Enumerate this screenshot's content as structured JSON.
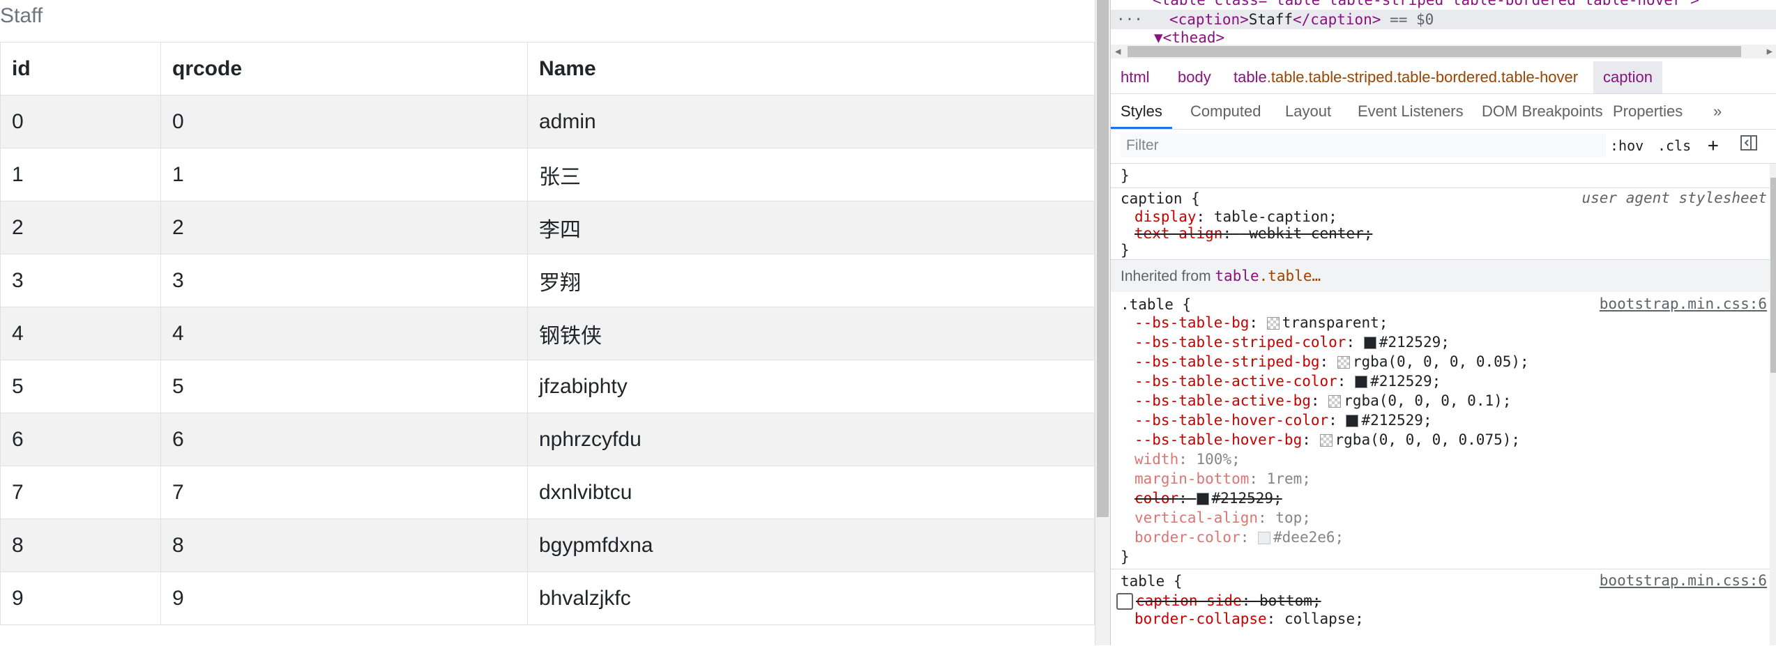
{
  "page": {
    "caption": "Staff",
    "columns": [
      "id",
      "qrcode",
      "Name"
    ],
    "rows": [
      [
        "0",
        "0",
        "admin"
      ],
      [
        "1",
        "1",
        "张三"
      ],
      [
        "2",
        "2",
        "李四"
      ],
      [
        "3",
        "3",
        "罗翔"
      ],
      [
        "4",
        "4",
        "钢铁侠"
      ],
      [
        "5",
        "5",
        "jfzabiphty"
      ],
      [
        "6",
        "6",
        "nphrzcyfdu"
      ],
      [
        "7",
        "7",
        "dxnlvibtcu"
      ],
      [
        "8",
        "8",
        "bgypmfdxna"
      ],
      [
        "9",
        "9",
        "bhvalzjkfc"
      ]
    ]
  },
  "devtools": {
    "elements": {
      "line1_tag": "<table class=\"table table-striped table-bordered table-hover\">",
      "line2_open": "<caption>",
      "line2_text": "Staff",
      "line2_close": "</caption>",
      "line2_suffix": " == $0",
      "line3": "▼<thead>",
      "dots": "···"
    },
    "breadcrumbs": {
      "html": "html",
      "body": "body",
      "table_tag": "table",
      "table_cls": ".table.table-striped.table-bordered.table-hover",
      "caption": "caption"
    },
    "tabs": [
      "Styles",
      "Computed",
      "Layout",
      "Event Listeners",
      "DOM Breakpoints",
      "Properties",
      "»"
    ],
    "filter": {
      "placeholder": "Filter",
      "hov": ":hov",
      "cls": ".cls",
      "plus": "+"
    },
    "rules": {
      "close_prev": "}",
      "caption_rule": {
        "selector": "caption",
        "origin": "user agent stylesheet",
        "decls": [
          {
            "prop": "display",
            "value": "table-caption;"
          },
          {
            "prop": "text-align",
            "value": "-webkit-center;"
          }
        ]
      },
      "inherited_label": "Inherited from",
      "inherited_tag": "table",
      "inherited_cls": ".table…",
      "table_class_rule": {
        "selector": ".table",
        "link": "bootstrap.min.css:6",
        "decls": [
          {
            "prop": "--bs-table-bg",
            "value": "transparent;",
            "swatch": "transparent"
          },
          {
            "prop": "--bs-table-striped-color",
            "value": "#212529;",
            "swatch": "#212529"
          },
          {
            "prop": "--bs-table-striped-bg",
            "value": "rgba(0, 0, 0, 0.05);",
            "swatch": "rgba(0,0,0,0.05)"
          },
          {
            "prop": "--bs-table-active-color",
            "value": "#212529;",
            "swatch": "#212529"
          },
          {
            "prop": "--bs-table-active-bg",
            "value": "rgba(0, 0, 0, 0.1);",
            "swatch": "rgba(0,0,0,0.1)"
          },
          {
            "prop": "--bs-table-hover-color",
            "value": "#212529;",
            "swatch": "#212529"
          },
          {
            "prop": "--bs-table-hover-bg",
            "value": "rgba(0, 0, 0, 0.075);",
            "swatch": "rgba(0,0,0,0.075)"
          },
          {
            "prop": "width",
            "value": "100%;"
          },
          {
            "prop": "margin-bottom",
            "value": "1rem;"
          },
          {
            "prop": "color",
            "value": "#212529;",
            "swatch": "#212529"
          },
          {
            "prop": "vertical-align",
            "value": "top;"
          },
          {
            "prop": "border-color",
            "value": "#dee2e6;",
            "swatch": "#dee2e6"
          }
        ]
      },
      "table_rule": {
        "selector": "table",
        "link": "bootstrap.min.css:6",
        "decls": [
          {
            "prop": "caption-side",
            "value": "bottom;"
          },
          {
            "prop": "border-collapse",
            "value": "collapse;"
          }
        ]
      }
    }
  }
}
